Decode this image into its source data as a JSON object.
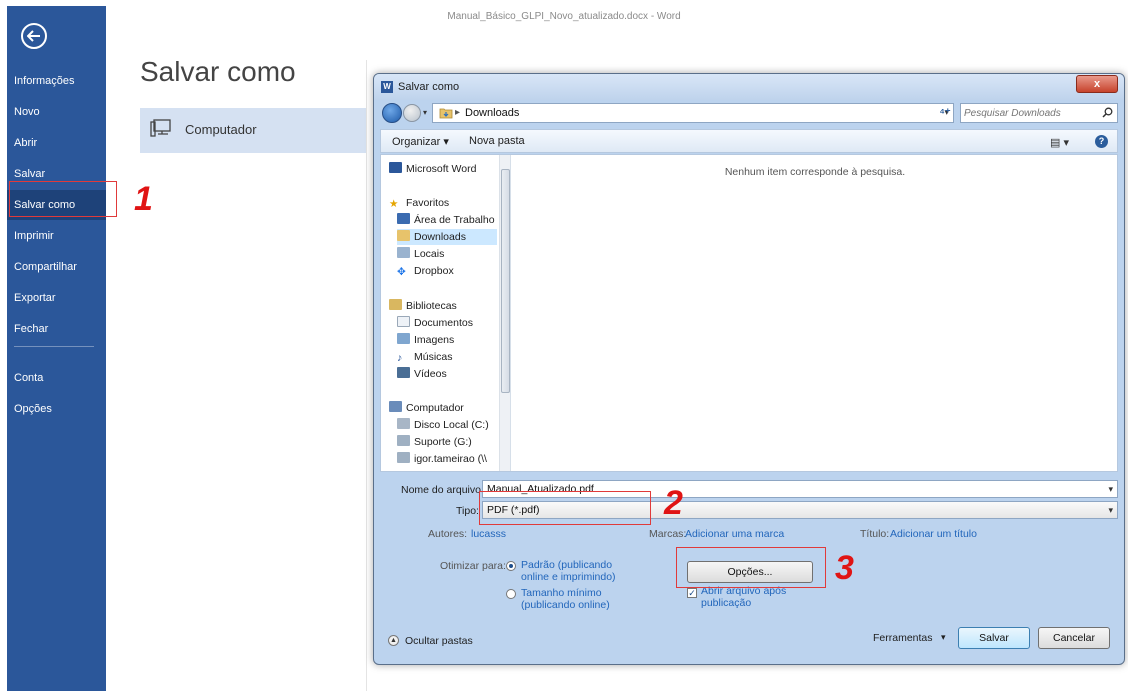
{
  "window": {
    "title": "Manual_Básico_GLPI_Novo_atualizado.docx - Word"
  },
  "sidebar": {
    "items": [
      {
        "label": "Informações"
      },
      {
        "label": "Novo"
      },
      {
        "label": "Abrir"
      },
      {
        "label": "Salvar"
      },
      {
        "label": "Salvar como",
        "active": true
      },
      {
        "label": "Imprimir"
      },
      {
        "label": "Compartilhar"
      },
      {
        "label": "Exportar"
      },
      {
        "label": "Fechar"
      },
      {
        "label": "Conta"
      },
      {
        "label": "Opções"
      }
    ]
  },
  "backstage": {
    "heading": "Salvar como",
    "place": "Computador"
  },
  "annotations": {
    "one": "1",
    "two": "2",
    "three": "3",
    "color": "#e01414"
  },
  "dialog": {
    "title": "Salvar como",
    "close_label": "x",
    "address": {
      "path": "Downloads"
    },
    "search": {
      "placeholder": "Pesquisar Downloads"
    },
    "toolbar": {
      "organize": "Organizar ▾",
      "new_folder": "Nova pasta"
    },
    "tree": {
      "word": "Microsoft Word",
      "favorites": "Favoritos",
      "desktop": "Área de Trabalho",
      "downloads": "Downloads",
      "locais": "Locais",
      "dropbox": "Dropbox",
      "libraries": "Bibliotecas",
      "documents": "Documentos",
      "images": "Imagens",
      "music": "Músicas",
      "videos": "Vídeos",
      "computer": "Computador",
      "disk_c": "Disco Local (C:)",
      "suporte": "Suporte (G:)",
      "igor": "igor.tameirao (\\\\"
    },
    "empty_message": "Nenhum item corresponde à pesquisa.",
    "form": {
      "filename_label": "Nome do arquivo:",
      "filename_value": "Manual_Atualizado.pdf",
      "type_label": "Tipo:",
      "type_value": "PDF (*.pdf)",
      "authors_label": "Autores:",
      "authors_value": "lucasss",
      "tags_label": "Marcas:",
      "tags_value": "Adicionar uma marca",
      "title_label": "Título:",
      "title_value": "Adicionar um título",
      "optimize_label": "Otimizar para:",
      "opt_standard": "Padrão (publicando online e imprimindo)",
      "opt_minimum": "Tamanho mínimo (publicando online)",
      "options_button": "Opções...",
      "open_after": "Abrir arquivo após publicação"
    },
    "footer": {
      "hide_folders": "Ocultar pastas",
      "tools": "Ferramentas",
      "save": "Salvar",
      "cancel": "Cancelar"
    }
  }
}
